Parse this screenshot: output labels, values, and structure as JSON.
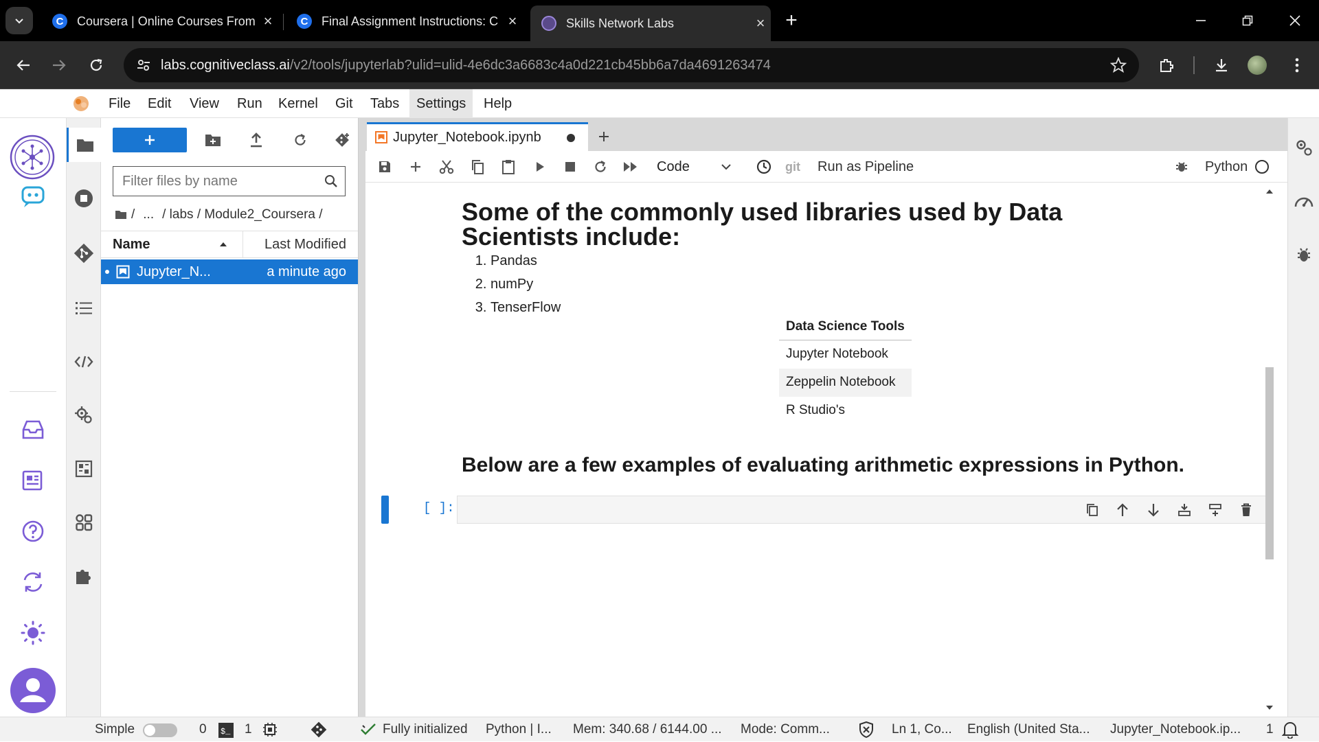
{
  "browser": {
    "tabs": [
      {
        "title": "Coursera | Online Courses From",
        "favicon": "C"
      },
      {
        "title": "Final Assignment Instructions: C",
        "favicon": "C"
      },
      {
        "title": "Skills Network Labs",
        "favicon": "skills-network-icon"
      }
    ],
    "url_host": "labs.cognitiveclass.ai",
    "url_path": "/v2/tools/jupyterlab?ulid=ulid-4e6dc3a6683c4a0d221cb45bb6a7da4691263474"
  },
  "menubar": {
    "items": [
      "File",
      "Edit",
      "View",
      "Run",
      "Kernel",
      "Git",
      "Tabs",
      "Settings",
      "Help"
    ]
  },
  "filebrowser": {
    "filter_placeholder": "Filter files by name",
    "breadcrumb_ellipsis": "...",
    "breadcrumb_path": "/ labs / Module2_Coursera /",
    "col_name": "Name",
    "col_modified": "Last Modified",
    "files": [
      {
        "name": "Jupyter_N...",
        "modified": "a minute ago"
      }
    ]
  },
  "notebook": {
    "tab_title": "Jupyter_Notebook.ipynb",
    "cell_type": "Code",
    "git_label": "git",
    "pipeline_label": "Run as Pipeline",
    "kernel_name": "Python",
    "heading1": "Some of the commonly used libraries used by Data Scientists include:",
    "libraries": [
      "Pandas",
      "numPy",
      "TenserFlow"
    ],
    "table_header": "Data Science Tools",
    "table_rows": [
      "Jupyter Notebook",
      "Zeppelin Notebook",
      "R Studio's"
    ],
    "heading2": "Below are a few examples of evaluating arithmetic expressions in Python.",
    "prompt": "[ ]:"
  },
  "statusbar": {
    "simple_label": "Simple",
    "terminals": "0",
    "kernels": "1",
    "kernel_status": "Fully initialized",
    "kernel_short": "Python | I...",
    "mem": "Mem: 340.68 / 6144.00 ...",
    "mode": "Mode: Comm...",
    "cursor": "Ln 1, Co...",
    "language": "English (United Sta...",
    "file": "Jupyter_Notebook.ip...",
    "notifications": "1"
  },
  "colors": {
    "accent": "#1976d2",
    "brand_purple": "#7b5cd6"
  }
}
